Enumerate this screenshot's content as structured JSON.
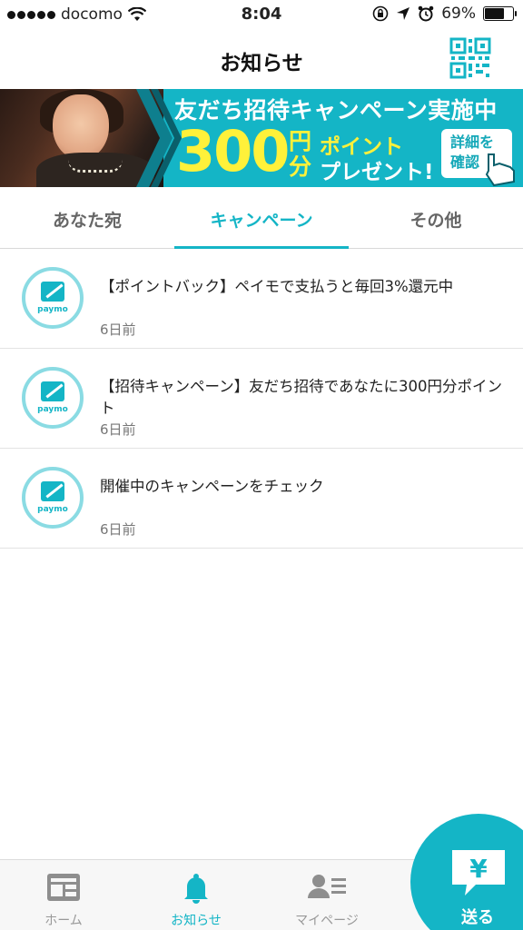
{
  "status_bar": {
    "carrier": "docomo",
    "time": "8:04",
    "battery": "69%",
    "battery_level": 0.69
  },
  "header": {
    "title": "お知らせ",
    "qr_icon": "qr-code-icon"
  },
  "banner": {
    "headline": "友だち招待キャンペーン実施中",
    "amount": "300",
    "unit": "円分",
    "point": "ポイント",
    "present": "プレゼント!",
    "cta": "詳細を確認",
    "cta_line1": "詳細を",
    "cta_line2": "確認"
  },
  "tabs": [
    {
      "label": "あなた宛",
      "active": false
    },
    {
      "label": "キャンペーン",
      "active": true
    },
    {
      "label": "その他",
      "active": false
    }
  ],
  "notifications": [
    {
      "title": "【ポイントバック】ペイモで支払うと毎回3%還元中",
      "time": "6日前",
      "avatar_text": "paymo"
    },
    {
      "title": "【招待キャンペーン】友だち招待であなたに300円分ポイント",
      "time": "6日前",
      "avatar_text": "paymo"
    },
    {
      "title": "開催中のキャンペーンをチェック",
      "time": "6日前",
      "avatar_text": "paymo"
    }
  ],
  "tabbar": {
    "home": "ホーム",
    "news": "お知らせ",
    "mypage": "マイページ",
    "send": "送る"
  },
  "colors": {
    "accent": "#14b5c6",
    "banner_yellow": "#fff13a"
  }
}
